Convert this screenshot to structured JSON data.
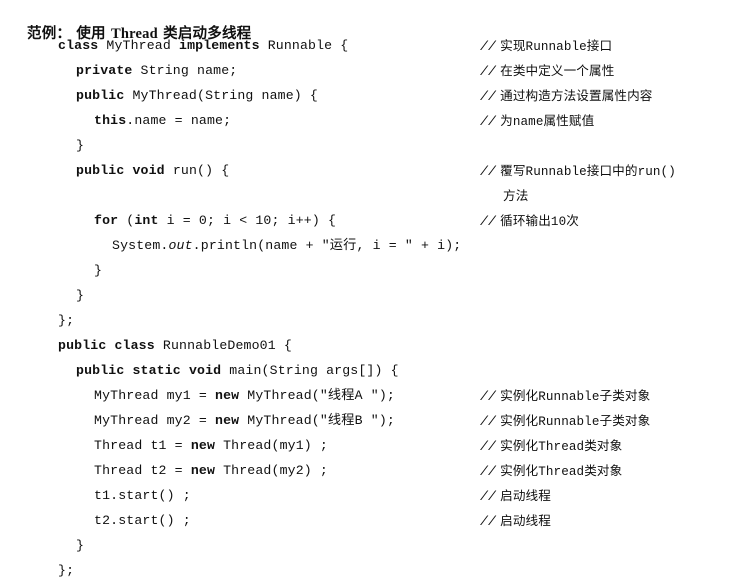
{
  "document": {
    "title_prefix": "范例：",
    "title_mid": "使用",
    "title_latin": "Thread",
    "title_suffix": "类启动多线程",
    "title_full": "范例： 使用 Thread 类启动多线程",
    "language": "Java",
    "class_name": "RunnableDemo01"
  },
  "code": {
    "lines": [
      {
        "indent": 2,
        "text": "class MyThread implements Runnable {"
      },
      {
        "indent": 4,
        "text": "private String name;"
      },
      {
        "indent": 4,
        "text": "public MyThread(String name) {"
      },
      {
        "indent": 6,
        "text": "this.name = name;"
      },
      {
        "indent": 4,
        "text": "}"
      },
      {
        "indent": 4,
        "text": "public void run() {"
      },
      {
        "indent": 0,
        "text": ""
      },
      {
        "indent": 6,
        "text": "for (int i = 0; i < 10; i++) {"
      },
      {
        "indent": 8,
        "text": "System.out.println(name + \"运行, i = \" + i);"
      },
      {
        "indent": 6,
        "text": "}"
      },
      {
        "indent": 4,
        "text": "}"
      },
      {
        "indent": 2,
        "text": "};"
      },
      {
        "indent": 2,
        "text": "public class RunnableDemo01 {"
      },
      {
        "indent": 4,
        "text": "public static void main(String args[]) {"
      },
      {
        "indent": 6,
        "text": "MyThread my1 = new MyThread(\"线程A \");"
      },
      {
        "indent": 6,
        "text": "MyThread my2 = new MyThread(\"线程B \");"
      },
      {
        "indent": 6,
        "text": "Thread t1 = new Thread(my1) ;"
      },
      {
        "indent": 6,
        "text": "Thread t2 = new Thread(my2) ;"
      },
      {
        "indent": 6,
        "text": "t1.start() ;"
      },
      {
        "indent": 6,
        "text": "t2.start() ;"
      },
      {
        "indent": 4,
        "text": "}"
      },
      {
        "indent": 2,
        "text": "};"
      }
    ]
  },
  "comments": [
    {
      "line": 0,
      "marker": "//",
      "text": "实现Runnable接口"
    },
    {
      "line": 1,
      "marker": "//",
      "text": "在类中定义一个属性"
    },
    {
      "line": 2,
      "marker": "//",
      "text": "通过构造方法设置属性内容"
    },
    {
      "line": 3,
      "marker": "//",
      "text": "为name属性赋值"
    },
    {
      "line": 5,
      "marker": "//",
      "text": "覆写Runnable接口中的run()"
    },
    {
      "line": 6,
      "marker": "",
      "text": "方法",
      "continuation": true
    },
    {
      "line": 7,
      "marker": "//",
      "text": "循环输出10次"
    },
    {
      "line": 14,
      "marker": "//",
      "text": "实例化Runnable子类对象"
    },
    {
      "line": 15,
      "marker": "//",
      "text": "实例化Runnable子类对象"
    },
    {
      "line": 16,
      "marker": "//",
      "text": "实例化Thread类对象"
    },
    {
      "line": 17,
      "marker": "//",
      "text": "实例化Thread类对象"
    },
    {
      "line": 18,
      "marker": "//",
      "text": "启动线程"
    },
    {
      "line": 19,
      "marker": "//",
      "text": "启动线程"
    }
  ],
  "style": {
    "background": "#ffffff",
    "text_color": "#101010"
  }
}
